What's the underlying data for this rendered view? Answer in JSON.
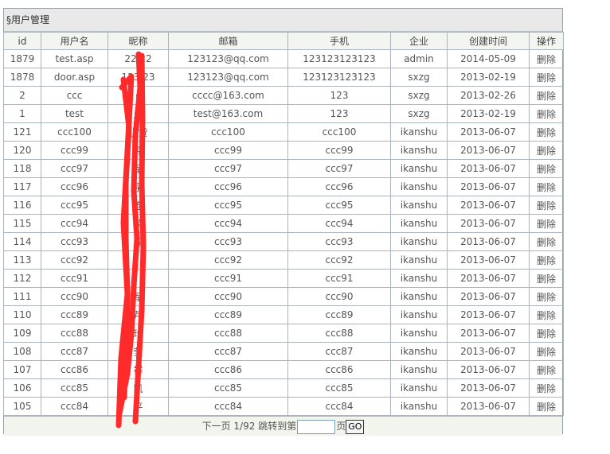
{
  "panel": {
    "title": "§用户管理"
  },
  "table": {
    "columns": [
      "id",
      "用户名",
      "昵称",
      "邮箱",
      "手机",
      "企业",
      "创建时间",
      "操作"
    ],
    "rows": [
      [
        "1879",
        "test.asp",
        "22  22",
        "123123@qq.com",
        "123123123123",
        "admin",
        "2014-05-09",
        "删除"
      ],
      [
        "1878",
        "door.asp",
        "123  23",
        "123123@qq.com",
        "123123123123",
        "sxzg",
        "2013-02-19",
        "删除"
      ],
      [
        "2",
        "ccc",
        "  c",
        "cccc@163.com",
        "123",
        "sxzg",
        "2013-02-26",
        "删除"
      ],
      [
        "1",
        "test",
        "  乐",
        "test@163.com",
        "123",
        "sxzg",
        "2013-02-19",
        "删除"
      ],
      [
        "121",
        "ccc100",
        "  小贷",
        "ccc100",
        "ccc100",
        "ikanshu",
        "2013-06-07",
        "删除"
      ],
      [
        "120",
        "ccc99",
        "  芹",
        "ccc99",
        "ccc99",
        "ikanshu",
        "2013-06-07",
        "删除"
      ],
      [
        "118",
        "ccc97",
        "  军",
        "ccc97",
        "ccc97",
        "ikanshu",
        "2013-06-07",
        "删除"
      ],
      [
        "117",
        "ccc96",
        "  泉",
        "ccc96",
        "ccc96",
        "ikanshu",
        "2013-06-07",
        "删除"
      ],
      [
        "116",
        "ccc95",
        "  连",
        "ccc95",
        "ccc95",
        "ikanshu",
        "2013-06-07",
        "删除"
      ],
      [
        "115",
        "ccc94",
        "  荣",
        "ccc94",
        "ccc94",
        "ikanshu",
        "2013-06-07",
        "删除"
      ],
      [
        "114",
        "ccc93",
        "  闯",
        "ccc93",
        "ccc93",
        "ikanshu",
        "2013-06-07",
        "删除"
      ],
      [
        "113",
        "ccc92",
        "",
        "ccc92",
        "ccc92",
        "ikanshu",
        "2013-06-07",
        "删除"
      ],
      [
        "112",
        "ccc91",
        "",
        "ccc91",
        "ccc91",
        "ikanshu",
        "2013-06-07",
        "删除"
      ],
      [
        "111",
        "ccc90",
        "  军",
        "ccc90",
        "ccc90",
        "ikanshu",
        "2013-06-07",
        "删除"
      ],
      [
        "110",
        "ccc89",
        "  芹",
        "ccc89",
        "ccc89",
        "ikanshu",
        "2013-06-07",
        "删除"
      ],
      [
        "109",
        "ccc88",
        "  玲",
        "ccc88",
        "ccc88",
        "ikanshu",
        "2013-06-07",
        "删除"
      ],
      [
        "108",
        "ccc87",
        "  莹",
        "ccc87",
        "ccc87",
        "ikanshu",
        "2013-06-07",
        "删除"
      ],
      [
        "107",
        "ccc86",
        "  祥",
        "ccc86",
        "ccc86",
        "ikanshu",
        "2013-06-07",
        "删除"
      ],
      [
        "106",
        "ccc85",
        "  凯",
        "ccc85",
        "ccc85",
        "ikanshu",
        "2013-06-07",
        "删除"
      ],
      [
        "105",
        "ccc84",
        "  平",
        "ccc84",
        "ccc84",
        "ikanshu",
        "2013-06-07",
        "删除"
      ]
    ]
  },
  "pager": {
    "next_label": "下一页",
    "page_info": "1/92",
    "jump_label": "跳转到第",
    "page_suffix": "页",
    "go_label": "GO",
    "input_value": ""
  },
  "colors": {
    "scribble": "#ff2a2a"
  }
}
